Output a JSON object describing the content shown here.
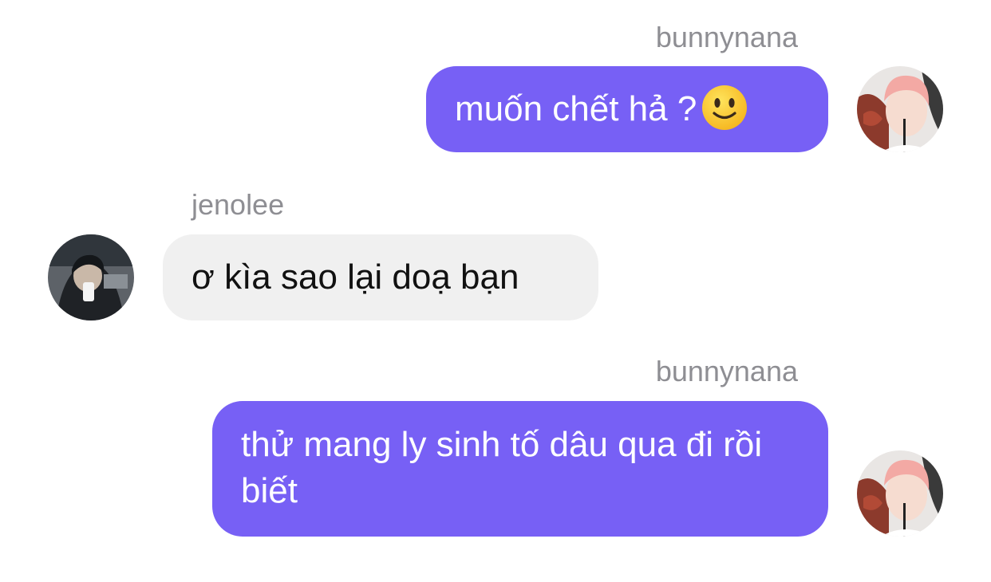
{
  "messages": [
    {
      "sender": "bunnynana",
      "direction": "outgoing",
      "text": "muốn chết hả ?",
      "emoji": "slightly-smiling-face"
    },
    {
      "sender": "jenolee",
      "direction": "incoming",
      "text": "ơ kìa sao lại doạ bạn"
    },
    {
      "sender": "bunnynana",
      "direction": "outgoing",
      "text": "thử mang ly sinh tố dâu qua đi rồi biết"
    }
  ],
  "colors": {
    "outgoing_bubble": "#7760f5",
    "incoming_bubble": "#f0f0f0",
    "sender_name": "#8e8e93",
    "background": "#ffffff"
  }
}
